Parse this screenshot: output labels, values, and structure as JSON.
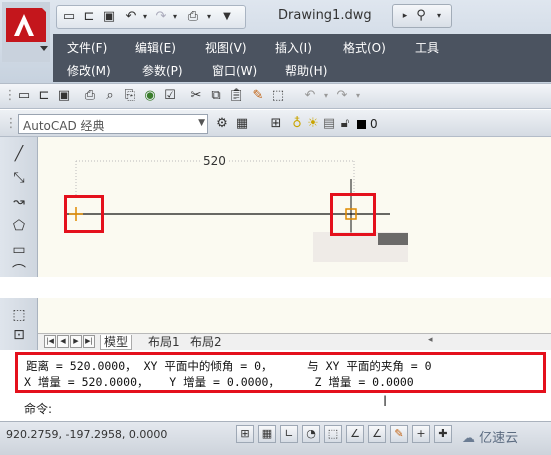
{
  "title_bar": {
    "document_title": "Drawing1.dwg",
    "binoculars_icon": "binoculars-icon"
  },
  "menu": {
    "row1": [
      "文件(F)",
      "编辑(E)",
      "视图(V)",
      "插入(I)",
      "格式(O)",
      "工具"
    ],
    "row2": [
      "修改(M)",
      "参数(P)",
      "窗口(W)",
      "帮助(H)"
    ]
  },
  "workspace": {
    "selected": "AutoCAD 经典",
    "layer_name": "0"
  },
  "drawing": {
    "dimension_value": "520"
  },
  "layout_tabs": {
    "model": "模型",
    "layout1": "布局1",
    "layout2": "布局2"
  },
  "command": {
    "line1": "距离 = 520.0000， XY 平面中的倾角 = 0，     与 XY 平面的夹角 = 0",
    "line2": "X 增量 = 520.0000，   Y 增量 = 0.0000，     Z 增量 = 0.0000",
    "prompt": "命令:"
  },
  "status": {
    "coordinates": "920.2759,   -197.2958, 0.0000"
  },
  "watermark": "亿速云",
  "colors": {
    "highlight_red": "#e4101c",
    "canvas_bg": "#fbfaf1",
    "menubar_bg": "#4b5360",
    "endpoint_marker": "#e08a00"
  }
}
